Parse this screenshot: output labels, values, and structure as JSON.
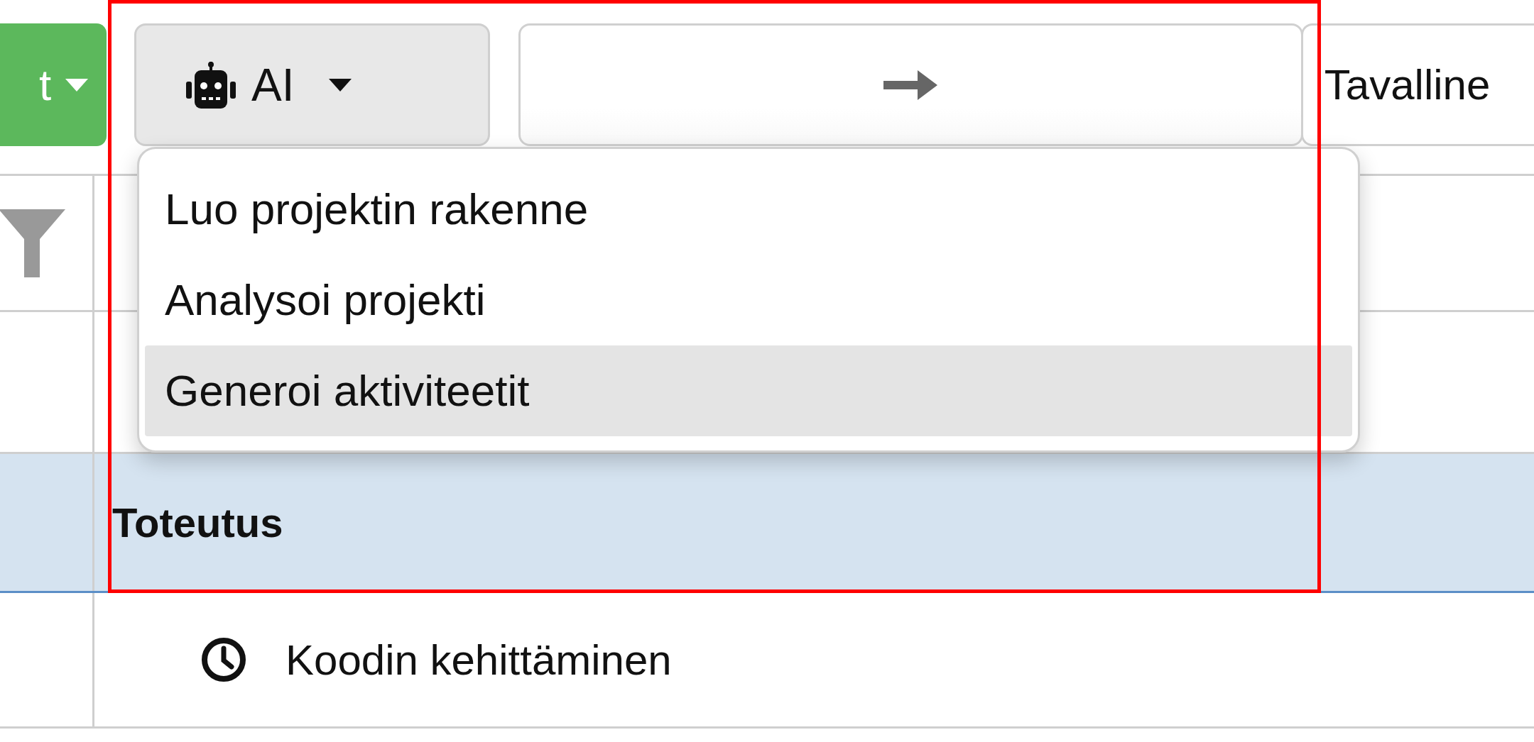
{
  "toolbar": {
    "green_button": {
      "label": "t"
    },
    "ai_button": {
      "label": "AI"
    },
    "select_field": {
      "value": "Tavalline"
    }
  },
  "ai_menu": {
    "items": [
      {
        "label": "Luo projektin rakenne",
        "selected": false
      },
      {
        "label": "Analysoi projekti",
        "selected": false
      },
      {
        "label": "Generoi aktiviteetit",
        "selected": true
      }
    ]
  },
  "table": {
    "rows": [
      {
        "kind": "group",
        "label": "Toteutus",
        "selected": true
      },
      {
        "kind": "task",
        "label": "Koodin kehittäminen",
        "selected": false
      }
    ]
  }
}
